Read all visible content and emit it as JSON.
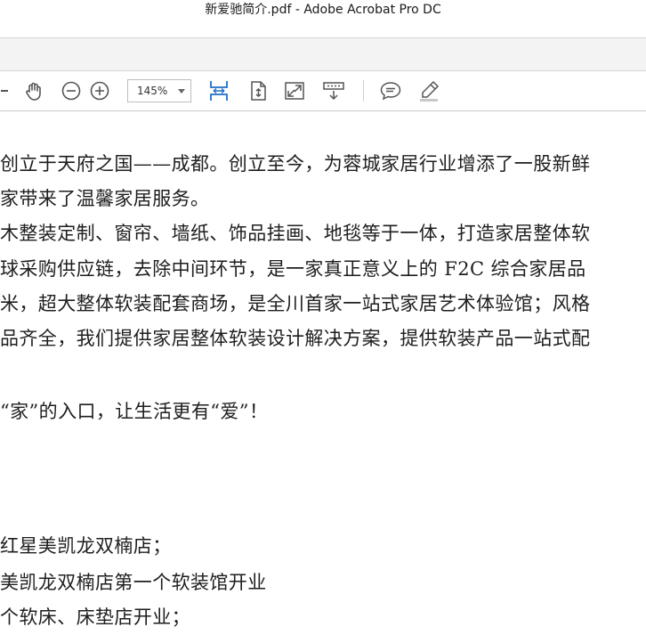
{
  "window": {
    "title": "新爱驰简介.pdf - Adobe Acrobat Pro DC"
  },
  "toolbar": {
    "zoom_value": "145%",
    "icons": [
      "prev-icon",
      "hand-tool-icon",
      "zoom-out-icon",
      "zoom-in-icon",
      "fit-width-icon",
      "fit-page-icon",
      "full-screen-icon",
      "read-mode-icon",
      "comment-icon",
      "highlight-icon"
    ]
  },
  "document": {
    "lines": [
      "创立于天府之国——成都。创立至今，为蓉城家居行业增添了一股新鲜",
      "家带来了温馨家居服务。",
      "木整装定制、窗帘、墙纸、饰品挂画、地毯等于一体，打造家居整体软",
      "球采购供应链，去除中间环节，是一家真正意义上的 F2C 综合家居品",
      "米，超大整体软装配套商场，是全川首家一站式家居艺术体验馆；风格",
      "品齐全，我们提供家居整体软装设计解决方案，提供软装产品一站式配",
      "“家”的入口，让生活更有“爱”！",
      "红星美凯龙双楠店；",
      "美凯龙双楠店第一个软装馆开业",
      "个软床、床垫店开业；"
    ]
  }
}
